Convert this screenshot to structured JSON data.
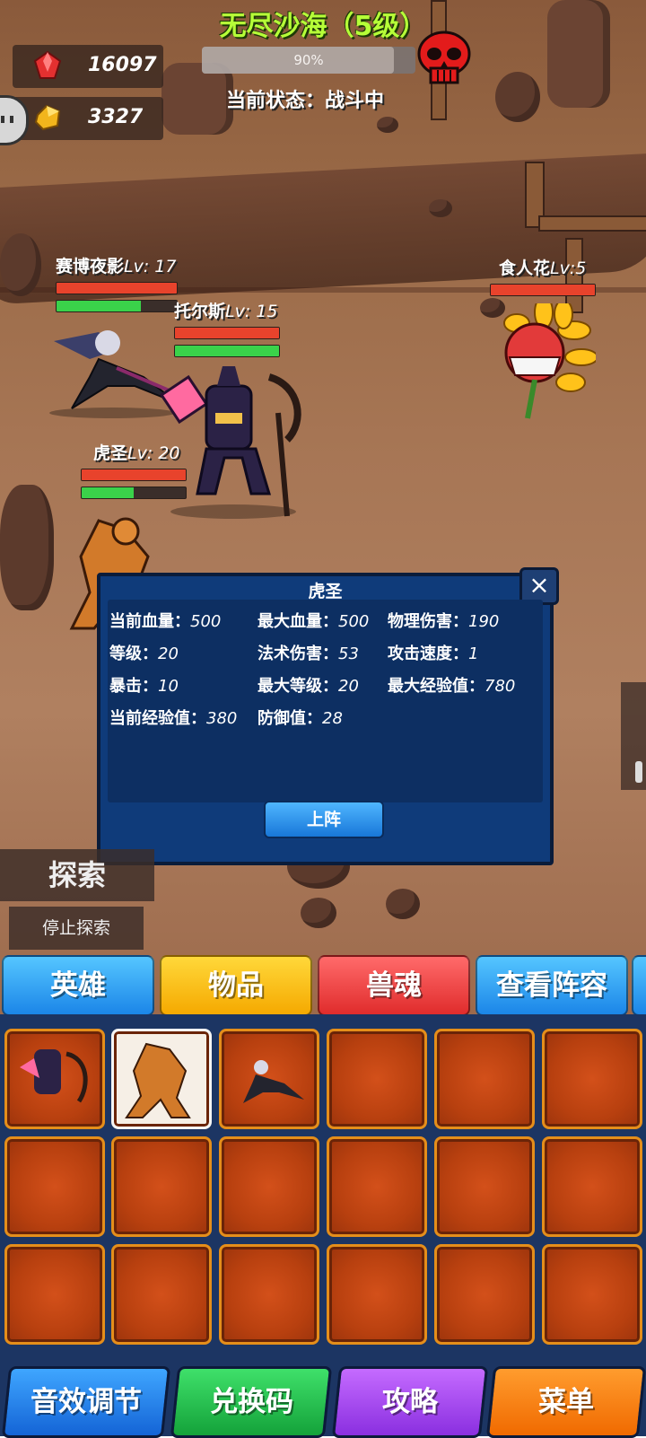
{
  "header": {
    "title": "无尽沙海（5级）",
    "progress_percent": 90,
    "progress_label": "90%",
    "status": "当前状态：战斗中"
  },
  "resources": {
    "gems": "16097",
    "gold": "3327"
  },
  "units": {
    "ally1": {
      "name": "赛博夜影",
      "lv": "Lv: 17",
      "hp": 1.0,
      "mp": 0.7
    },
    "ally2": {
      "name": "托尔斯",
      "lv": "Lv: 15",
      "hp": 1.0,
      "mp": 1.0
    },
    "ally3": {
      "name": "虎圣",
      "lv": "Lv: 20",
      "hp": 1.0,
      "mp": 0.5
    },
    "enemy1": {
      "name": "食人花",
      "lv": "Lv:5",
      "hp": 1.0
    }
  },
  "dialog": {
    "title": "虎圣",
    "stats": [
      {
        "label": "当前血量：",
        "value": "500"
      },
      {
        "label": "最大血量：",
        "value": "500"
      },
      {
        "label": "物理伤害：",
        "value": "190"
      },
      {
        "label": "等级：",
        "value": "20"
      },
      {
        "label": "法术伤害：",
        "value": "53"
      },
      {
        "label": "攻击速度：",
        "value": "1"
      },
      {
        "label": "暴击：",
        "value": "10"
      },
      {
        "label": "最大等级：",
        "value": "20"
      },
      {
        "label": "最大经验值：",
        "value": "780"
      },
      {
        "label": "当前经验值：",
        "value": "380"
      },
      {
        "label": "防御值：",
        "value": "28"
      }
    ],
    "close_icon": "×",
    "deploy_button": "上阵"
  },
  "explore": {
    "label": "探索",
    "stop": "停止探索"
  },
  "tabs": [
    "英雄",
    "物品",
    "兽魂",
    "查看阵容"
  ],
  "bottom": [
    "音效调节",
    "兑换码",
    "攻略",
    "菜单"
  ],
  "colors": {
    "title": "#b6ff38",
    "panel": "#0f3b7a",
    "inventory_bg": "#1c3563",
    "slot": "#c0450f"
  }
}
